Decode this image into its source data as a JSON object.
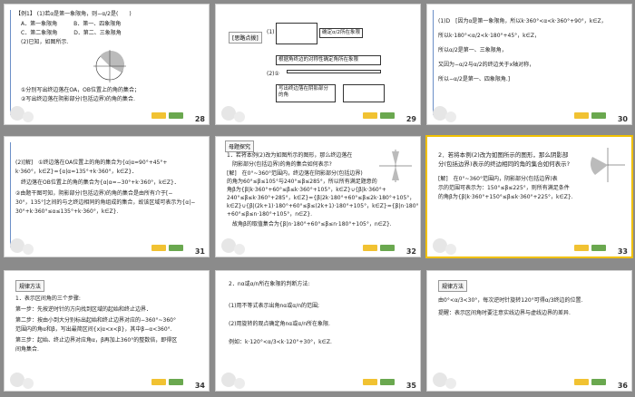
{
  "slides": [
    {
      "num": "28",
      "selected": false,
      "lines": [
        "【例1】 (1)若α是第一象限角，则−α/2是(　　)",
        "A．第一象限角　　　B．第一、四象限角",
        "C．第二象限角　　　D．第二、三象限角",
        "(2)已知，如图所示.",
        "",
        "",
        "",
        "①分别写出终边落在OA，OB位置上的角的集合；",
        "②写出终边落在阴影部分(包括边界)的角的集合."
      ]
    },
    {
      "num": "29",
      "selected": false,
      "lines": [
        "[思路点拨]",
        "(1)",
        "确定α/2所在象限",
        "(2)①",
        "根据角终边的对称性确定角所在象限",
        "写出终边落在阴影部分的角"
      ]
    },
    {
      "num": "30",
      "selected": false,
      "lines": [
        "(1)D　[因为α是第一象限角，所以k·360°<α<k·360°+90°，k∈Z，",
        "所以k·180°<α/2<k·180°+45°，k∈Z，",
        "所以α/2是第一、三象限角，",
        "又因为−α/2与α/2的终边关于x轴对称，",
        "所以−α/2是第一、四象限角.]"
      ]
    },
    {
      "num": "31",
      "selected": false,
      "lines": [
        "(2)[解]　①终边落在OA位置上的角的集合为{α|α=90°+45°+",
        "k·360°，k∈Z}={α|α=135°+k·360°，k∈Z}．",
        "　终边落在OB位置上的角的集合为{α|α=−30°+k·360°，k∈Z}．",
        "②由题干图可知，阴影部分(包括边界)的角的集合是由所有介于[−",
        "30°，135°]之间的与之终边相同的角组成的集合，故该区域可表示为{α|−",
        "30°+k·360°≤α≤135°+k·360°，k∈Z}."
      ]
    },
    {
      "num": "32",
      "selected": false,
      "lines": [
        "母题探究",
        "1．若将本例(2)改为如图所示的图形，那么终边落在",
        "阴影部分(包括边界)的角的集合如何表示?",
        "[解]　在0°~360°范围内，终边落在阴影部分(包括边界)",
        "的角为60°≤β≤105°与240°≤β≤285°，所以所有满足题意的",
        "角β为{β|k·360°+60°≤β≤k·360°+105°，k∈Z}∪{β|k·360°+",
        "240°≤β≤k·360°+285°，k∈Z}={β|2k·180°+60°≤β≤2k·180°+105°，",
        "k∈Z}∪{β|(2k+1)·180°+60°≤β≤(2k+1)·180°+105°，k∈Z}={β|n·180°",
        "+60°≤β≤n·180°+105°，n∈Z}.",
        "故角β的取值集合为{β|n·180°+60°≤β≤n·180°+105°，n∈Z}."
      ]
    },
    {
      "num": "33",
      "selected": true,
      "lines": [
        "2．若将本例(2)改为如图所示的图形，那么阴影部",
        "分(包括边界)表示的终边相同的角的集合如何表示?",
        "[解]　在0°~360°范围内，阴影部分(包括边界)表",
        "示的范围可表示为：150°≤β≤225°，则所有满足条件",
        "的角β为{β|k·360°+150°≤β≤k·360°+225°，k∈Z}."
      ]
    },
    {
      "num": "34",
      "selected": false,
      "lines": [
        "规律方法",
        "1．表示区间角的三个步骤:",
        "第一步：先按逆时针的方向找到区域的起始和终止边界．",
        "第二步：按由小到大分别标出起始和终止边界对应的−360°~360°",
        "范围内的角α和β，写出最简区间{x|α<x<β}，其中β−α<360°.",
        "第三步：起始、终止边界对应角α，β再加上360°的整数倍，即得区",
        "间角集合."
      ]
    },
    {
      "num": "35",
      "selected": false,
      "lines": [
        "2．nα或α/n所在象限的判断方法:",
        "(1)用不等式表示出角nα或α/n的范围;",
        "(2)用旋转的观点确定角nα或α/n所在象限.",
        "例如：k·120°<α/3<k·120°+30°，k∈Z."
      ]
    },
    {
      "num": "36",
      "selected": false,
      "lines": [
        "规律方法",
        "由0°<α/3<30°，每次逆时针旋转120°可得α/3终边的位置.",
        "提醒：表示区间角时要注意实线边界与虚线边界的差异."
      ]
    }
  ],
  "colors": {
    "accent_red": "#c00000",
    "line_blue": "#6b8fc7",
    "selected": "#f0c000"
  }
}
